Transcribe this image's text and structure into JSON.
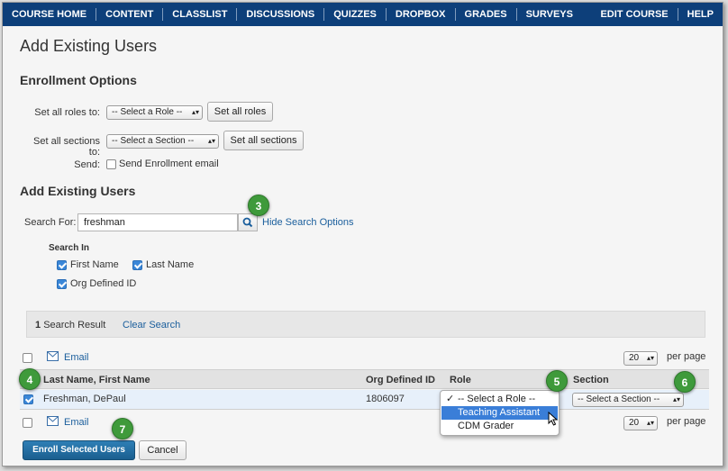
{
  "nav": {
    "left": [
      "COURSE HOME",
      "CONTENT",
      "CLASSLIST",
      "DISCUSSIONS",
      "QUIZZES",
      "DROPBOX",
      "GRADES",
      "SURVEYS"
    ],
    "right": [
      "EDIT COURSE",
      "HELP"
    ]
  },
  "page_title": "Add Existing Users",
  "enrollment": {
    "title": "Enrollment Options",
    "roles_label": "Set all roles to:",
    "roles_select": "-- Select a Role --",
    "roles_button": "Set all roles",
    "sections_label": "Set all sections to:",
    "sections_select": "-- Select a Section --",
    "sections_button": "Set all sections",
    "send_label": "Send:",
    "send_checkbox": "Send Enrollment email"
  },
  "search": {
    "title": "Add Existing Users",
    "label": "Search For:",
    "value": "freshman",
    "hide_link": "Hide Search Options",
    "search_in": "Search In",
    "options": [
      "First Name",
      "Last Name",
      "Org Defined ID"
    ]
  },
  "results": {
    "count_number": "1",
    "count_label": "Search Result",
    "clear": "Clear Search"
  },
  "grid": {
    "email_label": "Email",
    "per_page_value": "20",
    "per_page_label": "per page",
    "headers": {
      "name": "Last Name, First Name",
      "org_id": "Org Defined ID",
      "role": "Role",
      "section": "Section"
    },
    "rows": [
      {
        "name": "Freshman, DePaul",
        "org_id": "1806097",
        "section": "-- Select a Section --"
      }
    ],
    "role_options": [
      "-- Select a Role --",
      "Teaching Assistant",
      "CDM Grader"
    ]
  },
  "footer": {
    "enroll": "Enroll Selected Users",
    "cancel": "Cancel"
  },
  "badges": [
    "3",
    "4",
    "5",
    "6",
    "7"
  ],
  "colors": {
    "nav": "#0d3f7a",
    "badge": "#3f9a3b",
    "link": "#1a5e9c",
    "primary": "#1b5f8f",
    "highlight": "#3a7ed8"
  }
}
